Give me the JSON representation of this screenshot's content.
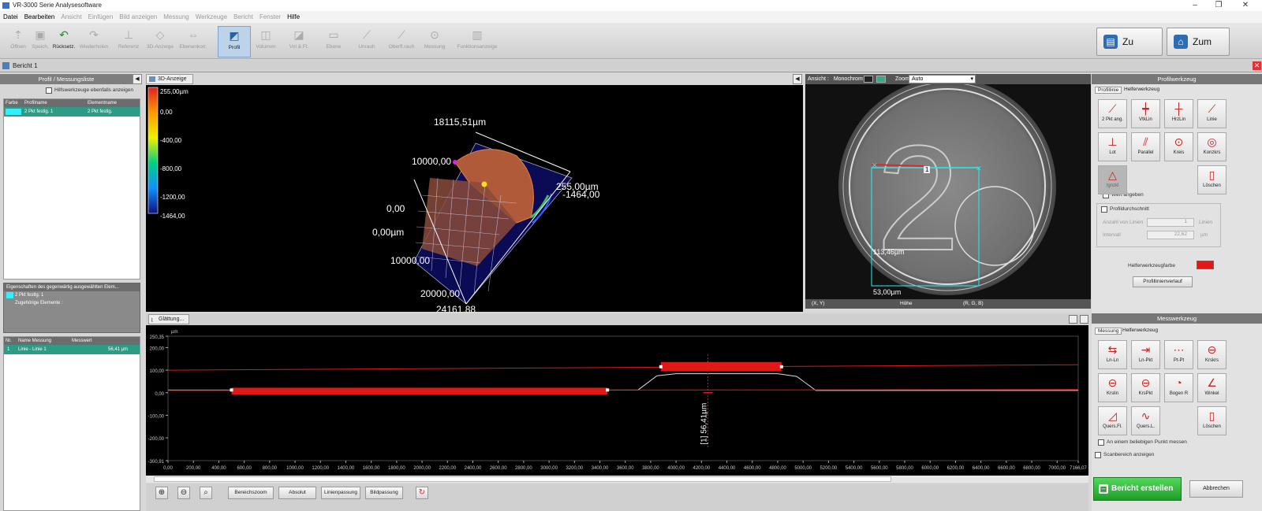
{
  "window": {
    "title": "VR-3000 Serie Analysesoftware"
  },
  "menu": [
    {
      "label": "Datei",
      "enabled": true
    },
    {
      "label": "Bearbeiten",
      "enabled": true
    },
    {
      "label": "Ansicht",
      "enabled": false
    },
    {
      "label": "Einfügen",
      "enabled": false
    },
    {
      "label": "Bild anzeigen",
      "enabled": false
    },
    {
      "label": "Messung",
      "enabled": false
    },
    {
      "label": "Werkzeuge",
      "enabled": false
    },
    {
      "label": "Bericht",
      "enabled": false
    },
    {
      "label": "Fenster",
      "enabled": false
    },
    {
      "label": "Hilfe",
      "enabled": true
    }
  ],
  "toolbar": {
    "items": [
      "Öffnen",
      "Speich.",
      "Rücksetz.",
      "Wiederholen",
      "Referenz",
      "3D-Anzeige",
      "Ebenenkorr.",
      "Profil",
      "Volumen",
      "Vol & Fl.",
      "Ebene",
      "Unrauh",
      "Oberfl.rauh",
      "Messung",
      "Funktionsanzeige"
    ],
    "zu_viewer": "Zu Viewer",
    "zum_menu": "Zum Menü"
  },
  "tab": {
    "label": "Bericht 1"
  },
  "left": {
    "profile_header": "Profil / Messungsliste",
    "helper_checkbox": "Hilfswerkzeuge ebenfalls anzeigen",
    "profile_cols": [
      "Farbe",
      "Profilname",
      "Elementname"
    ],
    "profile_rows": [
      {
        "name": "2 Pkt festlg. 1",
        "element": "2 Pkt festlg."
      }
    ],
    "props_header": "Eigenschaften des gegenwärtig ausgewählten Elem...",
    "props_name": "2 Pkt festlg. 1",
    "props_sub": "Zugehörige Elemente :",
    "meas_cols": [
      "Nr.",
      "Name Messung",
      "Messwert"
    ],
    "meas_rows": [
      {
        "nr": "1",
        "name": "Linie - Linie 1",
        "value": "56,41 µm"
      }
    ]
  },
  "view3d": {
    "tab": "3D-Anzeige",
    "legend": [
      "255,00µm",
      "0,00",
      "-400,00",
      "-800,00",
      "-1200,00",
      "-1464,00"
    ],
    "labels": {
      "top": "18115,51µm",
      "l1": "10000,00",
      "right1": "255,00µm",
      "right2": "-1464,00",
      "z0": "0,00",
      "x0": "0,00µm",
      "x1": "10000,00",
      "x2": "20000,00",
      "x3": "24161,88"
    }
  },
  "view2d": {
    "ansicht": "Ansicht :",
    "mode": "Monochrom",
    "zoom_label": "Zoom",
    "zoom_value": "Auto",
    "dim1": "113,46µm",
    "dim2": "53,00µm",
    "marker": "1",
    "status": [
      "(X, Y)",
      "Höhe",
      "(R, G, B)"
    ]
  },
  "profiltool": {
    "header": "Profilwerkzeug",
    "tabs": [
      "Profillinie",
      "Helferwerkzeug"
    ],
    "buttons": [
      "2 Pkt ang.",
      "VtkLin",
      "HrzLin",
      "Linie",
      "Lot",
      "Parallel",
      "Kreis",
      "Konzkrs",
      "Ignzkl",
      "Löschen"
    ],
    "wert": "Wert angeben",
    "durchschnitt": "Profildurchschnitt",
    "anzahl_label": "Anzahl von Linien",
    "anzahl": "1",
    "intervall_label": "Intervall",
    "intervall": "22,62",
    "unit_lines": "Linien",
    "unit_um": "µm",
    "farbe": "Helferwerkzeugfarbe",
    "verlauf": "Profillinienverlauf"
  },
  "profile": {
    "tab": "Glättung...",
    "unit": "µm",
    "ylabels": [
      "250,35",
      "200,00",
      "100,00",
      "0,00",
      "-100,00",
      "-200,00",
      "-300,91"
    ],
    "xlabels": [
      "0,00",
      "200,00",
      "400,00",
      "600,00",
      "800,00",
      "1000,00",
      "1200,00",
      "1400,00",
      "1600,00",
      "1800,00",
      "2000,00",
      "2200,00",
      "2400,00",
      "2600,00",
      "2800,00",
      "3000,00",
      "3200,00",
      "3400,00",
      "3600,00",
      "3800,00",
      "4000,00",
      "4200,00",
      "4400,00",
      "4600,00",
      "4800,00",
      "5000,00",
      "5200,00",
      "5400,00",
      "5600,00",
      "5800,00",
      "6000,00",
      "6200,00",
      "6400,00",
      "6600,00",
      "6800,00",
      "7000,00",
      "7166,07"
    ],
    "measure": "[1] 56,41µm"
  },
  "messtool": {
    "header": "Messwerkzeug",
    "tabs": [
      "Messung",
      "Helferwerkzeug"
    ],
    "buttons": [
      "Ln-Ln",
      "Ln-Pkt",
      "Pt-Pt",
      "Krskrs",
      "Krslin",
      "KrsPkt",
      "Bogen R",
      "Winkel",
      "Quers.Fl.",
      "Quers.L.",
      "Löschen"
    ],
    "punkt": "An einem beliebigen Punkt messen",
    "scan": "Scanbereich anzeigen"
  },
  "bottom": {
    "zoom_in": "zoom-in",
    "zoom_out": "zoom-out",
    "bereich": "Bereichszoom",
    "absolut": "Absolut",
    "linien": "Linienpassung",
    "bild": "Bildpassung"
  },
  "footer": {
    "create": "Bericht erstellen",
    "cancel": "Abbrechen"
  }
}
